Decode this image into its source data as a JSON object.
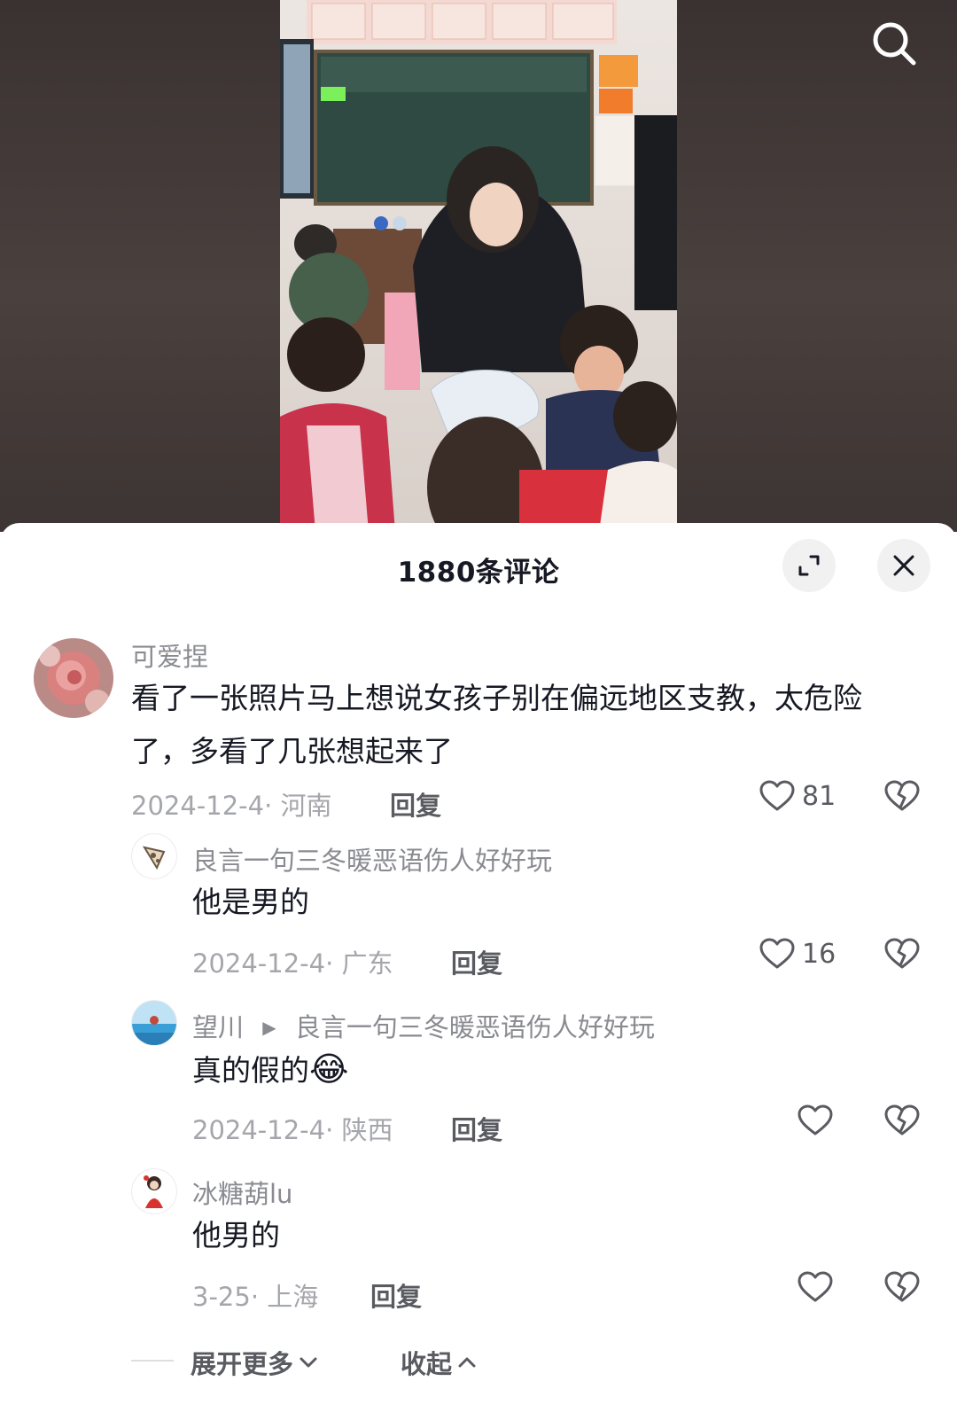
{
  "header": {
    "search_icon": "search-icon"
  },
  "sheet": {
    "title": "1880条评论"
  },
  "comments": [
    {
      "username": "可爱捏",
      "text": "看了一张照片马上想说女孩子别在偏远地区支教，太危险了，多看了几张想起来了",
      "meta": "2024-12-4· 河南",
      "reply_label": "回复",
      "likes": "81"
    }
  ],
  "replies": [
    {
      "username": "良言一句三冬暖恶语伤人好好玩",
      "text": "他是男的",
      "meta": "2024-12-4· 广东",
      "reply_label": "回复",
      "likes": "16"
    },
    {
      "username": "望川",
      "reply_to": "良言一句三冬暖恶语伤人好好玩",
      "text": "真的假的",
      "emoji": "😂",
      "meta": "2024-12-4· 陕西",
      "reply_label": "回复",
      "likes": ""
    },
    {
      "username": "冰糖葫lu",
      "text": "他男的",
      "meta": "3-25· 上海",
      "reply_label": "回复",
      "likes": ""
    }
  ],
  "footer": {
    "expand_more": "展开更多",
    "collapse": "收起"
  },
  "colors": {
    "text": "#161823",
    "secondary": "#8a8b91",
    "meta": "#a5a6ab",
    "sheet_bg": "#ffffff"
  }
}
